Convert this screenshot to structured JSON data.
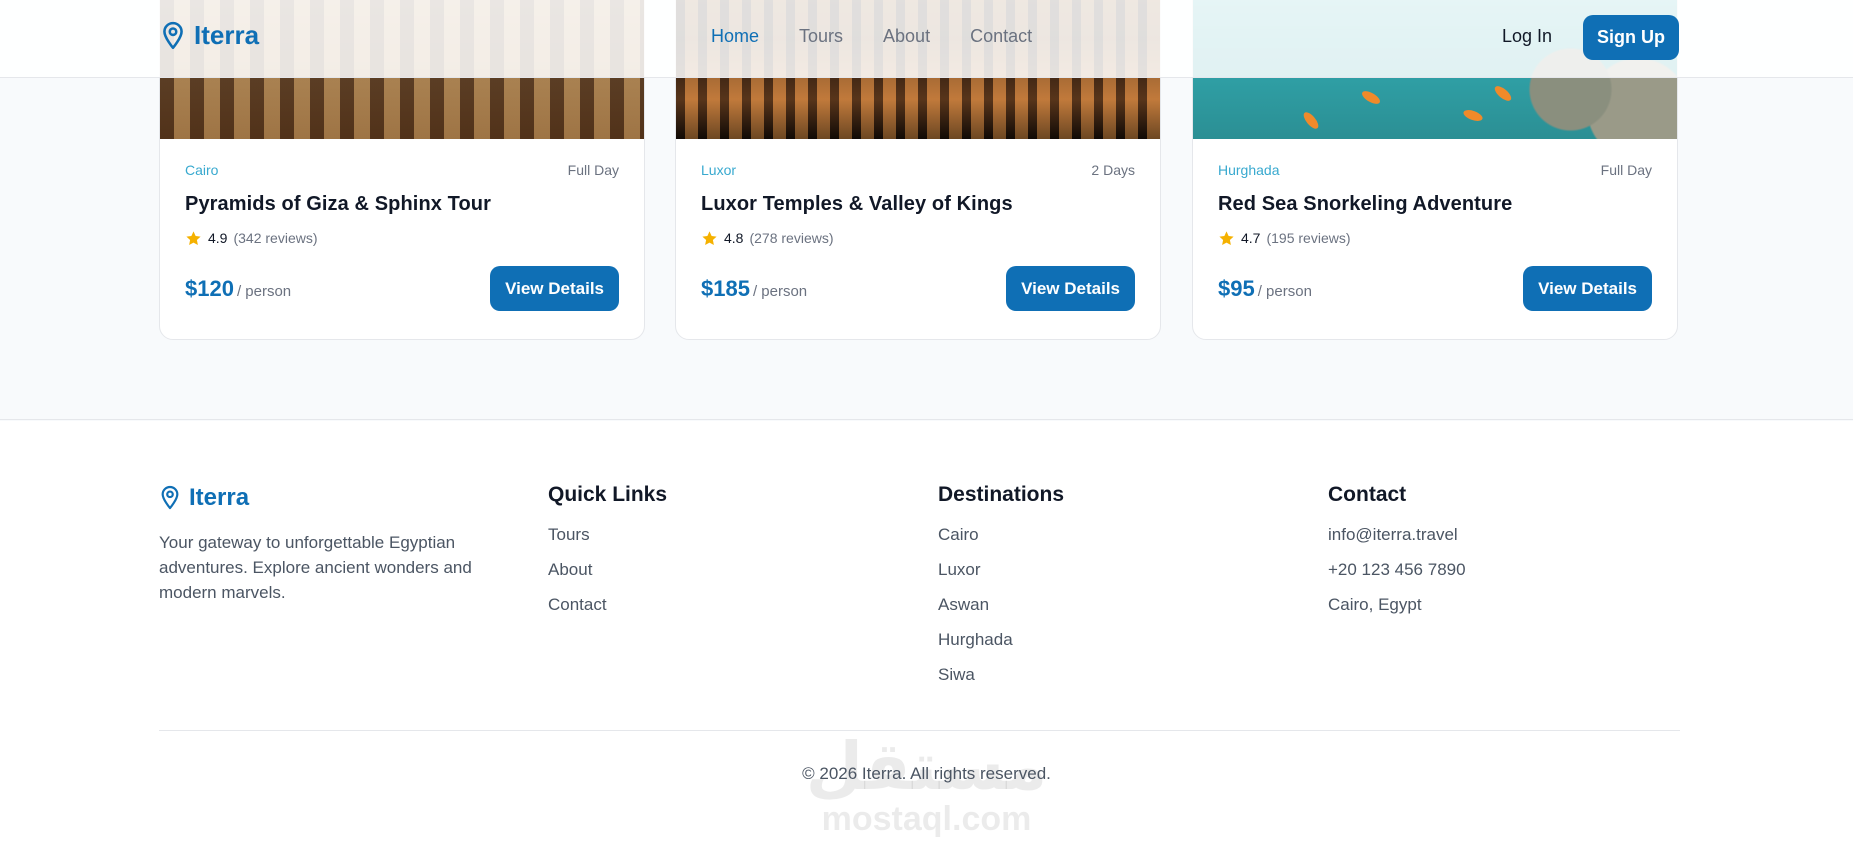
{
  "header": {
    "brand": "Iterra",
    "nav": [
      {
        "label": "Home",
        "active": true
      },
      {
        "label": "Tours",
        "active": false
      },
      {
        "label": "About",
        "active": false
      },
      {
        "label": "Contact",
        "active": false
      }
    ],
    "login_label": "Log In",
    "signup_label": "Sign Up"
  },
  "cards": [
    {
      "location": "Cairo",
      "duration": "Full Day",
      "title": "Pyramids of Giza & Sphinx Tour",
      "rating": "4.9",
      "reviews": "(342 reviews)",
      "price": "$120",
      "per": "/ person",
      "button": "View Details",
      "image": "market-photo"
    },
    {
      "location": "Luxor",
      "duration": "2 Days",
      "title": "Luxor Temples & Valley of Kings",
      "rating": "4.8",
      "reviews": "(278 reviews)",
      "price": "$185",
      "per": "/ person",
      "button": "View Details",
      "image": "temple-photo"
    },
    {
      "location": "Hurghada",
      "duration": "Full Day",
      "title": "Red Sea Snorkeling Adventure",
      "rating": "4.7",
      "reviews": "(195 reviews)",
      "price": "$95",
      "per": "/ person",
      "button": "View Details",
      "image": "reef-photo"
    }
  ],
  "footer": {
    "brand": "Iterra",
    "description": "Your gateway to unforgettable Egyptian adventures. Explore ancient wonders and modern marvels.",
    "quick_links": {
      "heading": "Quick Links",
      "items": [
        "Tours",
        "About",
        "Contact"
      ]
    },
    "destinations": {
      "heading": "Destinations",
      "items": [
        "Cairo",
        "Luxor",
        "Aswan",
        "Hurghada",
        "Siwa"
      ]
    },
    "contact": {
      "heading": "Contact",
      "items": [
        "info@iterra.travel",
        "+20 123 456 7890",
        "Cairo, Egypt"
      ]
    },
    "copyright": "© 2026 Iterra. All rights reserved.",
    "watermark_ar": "مستقل",
    "watermark_en": "mostaql.com"
  },
  "colors": {
    "primary": "#0f6fb5",
    "accent": "#38a9cf",
    "star": "#f5b100",
    "muted": "#6b7280"
  },
  "icons": {
    "logo": "map-pin-icon",
    "rating": "star-icon"
  }
}
